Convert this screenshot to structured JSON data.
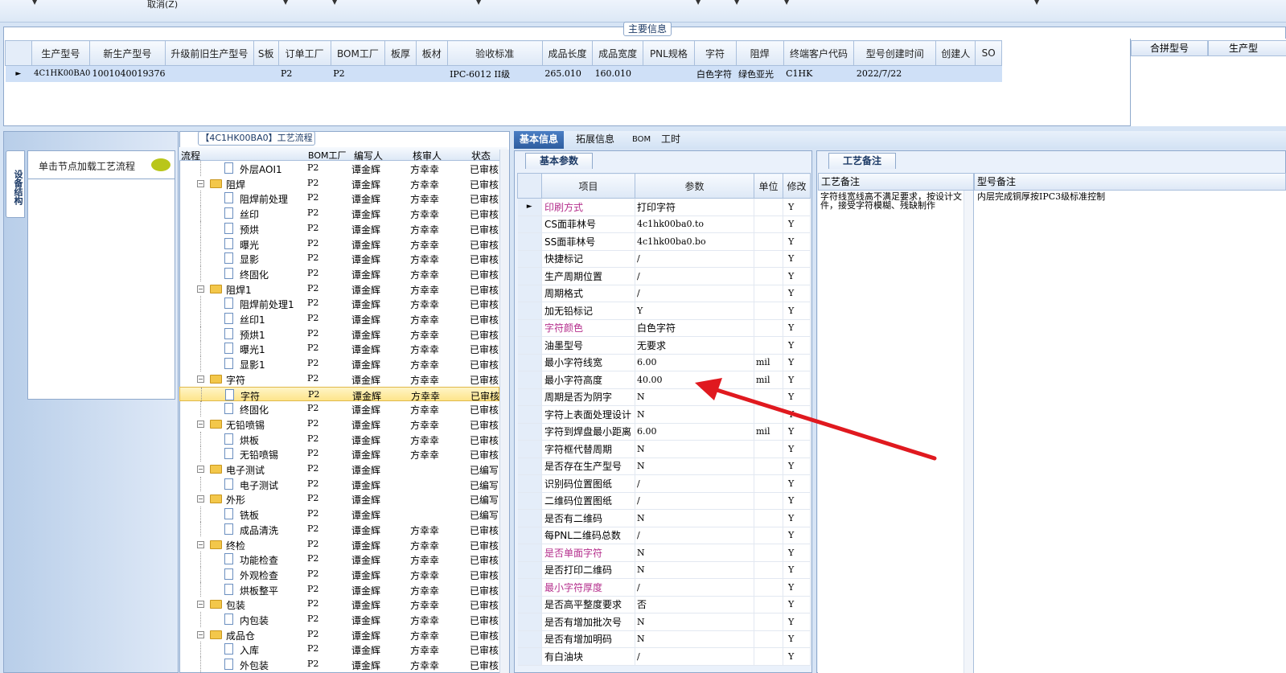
{
  "toolbar": {
    "cancel_label": "取消(Z)"
  },
  "main": {
    "title": "主要信息",
    "columns": [
      "生产型号",
      "新生产型号",
      "升级前旧生产型号",
      "S板",
      "订单工厂",
      "BOM工厂",
      "板厚",
      "板材",
      "验收标准",
      "成品长度",
      "成品宽度",
      "PNL规格",
      "字符",
      "阻焊",
      "终端客户代码",
      "型号创建时间",
      "创建人",
      "SO"
    ],
    "row": [
      "4C1HK00BA0",
      "10010400193760",
      "",
      "",
      "P2",
      "P2",
      "",
      "",
      "IPC-6012 II级",
      "265.010",
      "160.010",
      "",
      "白色字符",
      "绿色亚光",
      "C1HK",
      "2022/7/22",
      "",
      ""
    ]
  },
  "merge": {
    "columns": [
      "合拼型号",
      "生产型"
    ]
  },
  "side": {
    "tab_label": "设备结构",
    "node_hint": "单击节点加载工艺流程"
  },
  "tree": {
    "title": "【4C1HK00BA0】工艺流程",
    "headers": {
      "flow": "流程",
      "bom": "BOM工厂",
      "writer": "编写人",
      "reviewer": "核审人",
      "status": "状态"
    },
    "rows": [
      {
        "name": "外层AOI1",
        "level": 2,
        "bom": "P2",
        "writer": "谭金辉",
        "reviewer": "方幸幸",
        "status": "已审核"
      },
      {
        "name": "阻焊",
        "level": 1,
        "bom": "P2",
        "writer": "谭金辉",
        "reviewer": "方幸幸",
        "status": "已审核"
      },
      {
        "name": "阻焊前处理",
        "level": 2,
        "bom": "P2",
        "writer": "谭金辉",
        "reviewer": "方幸幸",
        "status": "已审核"
      },
      {
        "name": "丝印",
        "level": 2,
        "bom": "P2",
        "writer": "谭金辉",
        "reviewer": "方幸幸",
        "status": "已审核"
      },
      {
        "name": "预烘",
        "level": 2,
        "bom": "P2",
        "writer": "谭金辉",
        "reviewer": "方幸幸",
        "status": "已审核"
      },
      {
        "name": "曝光",
        "level": 2,
        "bom": "P2",
        "writer": "谭金辉",
        "reviewer": "方幸幸",
        "status": "已审核"
      },
      {
        "name": "显影",
        "level": 2,
        "bom": "P2",
        "writer": "谭金辉",
        "reviewer": "方幸幸",
        "status": "已审核"
      },
      {
        "name": "终固化",
        "level": 2,
        "bom": "P2",
        "writer": "谭金辉",
        "reviewer": "方幸幸",
        "status": "已审核"
      },
      {
        "name": "阻焊1",
        "level": 1,
        "bom": "P2",
        "writer": "谭金辉",
        "reviewer": "方幸幸",
        "status": "已审核"
      },
      {
        "name": "阻焊前处理1",
        "level": 2,
        "bom": "P2",
        "writer": "谭金辉",
        "reviewer": "方幸幸",
        "status": "已审核"
      },
      {
        "name": "丝印1",
        "level": 2,
        "bom": "P2",
        "writer": "谭金辉",
        "reviewer": "方幸幸",
        "status": "已审核"
      },
      {
        "name": "预烘1",
        "level": 2,
        "bom": "P2",
        "writer": "谭金辉",
        "reviewer": "方幸幸",
        "status": "已审核"
      },
      {
        "name": "曝光1",
        "level": 2,
        "bom": "P2",
        "writer": "谭金辉",
        "reviewer": "方幸幸",
        "status": "已审核"
      },
      {
        "name": "显影1",
        "level": 2,
        "bom": "P2",
        "writer": "谭金辉",
        "reviewer": "方幸幸",
        "status": "已审核"
      },
      {
        "name": "字符",
        "level": 1,
        "bom": "P2",
        "writer": "谭金辉",
        "reviewer": "方幸幸",
        "status": "已审核"
      },
      {
        "name": "字符",
        "level": 2,
        "bom": "P2",
        "writer": "谭金辉",
        "reviewer": "方幸幸",
        "status": "已审核",
        "selected": true
      },
      {
        "name": "终固化",
        "level": 2,
        "bom": "P2",
        "writer": "谭金辉",
        "reviewer": "方幸幸",
        "status": "已审核"
      },
      {
        "name": "无铅喷锡",
        "level": 1,
        "bom": "P2",
        "writer": "谭金辉",
        "reviewer": "方幸幸",
        "status": "已审核"
      },
      {
        "name": "烘板",
        "level": 2,
        "bom": "P2",
        "writer": "谭金辉",
        "reviewer": "方幸幸",
        "status": "已审核"
      },
      {
        "name": "无铅喷锡",
        "level": 2,
        "bom": "P2",
        "writer": "谭金辉",
        "reviewer": "方幸幸",
        "status": "已审核"
      },
      {
        "name": "电子测试",
        "level": 1,
        "bom": "P2",
        "writer": "谭金辉",
        "reviewer": "",
        "status": "已编写"
      },
      {
        "name": "电子测试",
        "level": 2,
        "bom": "P2",
        "writer": "谭金辉",
        "reviewer": "",
        "status": "已编写"
      },
      {
        "name": "外形",
        "level": 1,
        "bom": "P2",
        "writer": "谭金辉",
        "reviewer": "",
        "status": "已编写"
      },
      {
        "name": "铣板",
        "level": 2,
        "bom": "P2",
        "writer": "谭金辉",
        "reviewer": "",
        "status": "已编写"
      },
      {
        "name": "成品清洗",
        "level": 2,
        "bom": "P2",
        "writer": "谭金辉",
        "reviewer": "方幸幸",
        "status": "已审核"
      },
      {
        "name": "终检",
        "level": 1,
        "bom": "P2",
        "writer": "谭金辉",
        "reviewer": "方幸幸",
        "status": "已审核"
      },
      {
        "name": "功能检查",
        "level": 2,
        "bom": "P2",
        "writer": "谭金辉",
        "reviewer": "方幸幸",
        "status": "已审核"
      },
      {
        "name": "外观检查",
        "level": 2,
        "bom": "P2",
        "writer": "谭金辉",
        "reviewer": "方幸幸",
        "status": "已审核"
      },
      {
        "name": "烘板整平",
        "level": 2,
        "bom": "P2",
        "writer": "谭金辉",
        "reviewer": "方幸幸",
        "status": "已审核"
      },
      {
        "name": "包装",
        "level": 1,
        "bom": "P2",
        "writer": "谭金辉",
        "reviewer": "方幸幸",
        "status": "已审核"
      },
      {
        "name": "内包装",
        "level": 2,
        "bom": "P2",
        "writer": "谭金辉",
        "reviewer": "方幸幸",
        "status": "已审核"
      },
      {
        "name": "成品仓",
        "level": 1,
        "bom": "P2",
        "writer": "谭金辉",
        "reviewer": "方幸幸",
        "status": "已审核"
      },
      {
        "name": "入库",
        "level": 2,
        "bom": "P2",
        "writer": "谭金辉",
        "reviewer": "方幸幸",
        "status": "已审核"
      },
      {
        "name": "外包装",
        "level": 2,
        "bom": "P2",
        "writer": "谭金辉",
        "reviewer": "方幸幸",
        "status": "已审核"
      }
    ]
  },
  "tabs": [
    "基本信息",
    "拓展信息",
    "BOM",
    "工时"
  ],
  "basic": {
    "title": "基本参数",
    "headers": {
      "item": "项目",
      "param": "参数",
      "unit": "单位",
      "edit": "修改"
    },
    "rows": [
      {
        "item": "印刷方式",
        "value": "打印字符",
        "unit": "",
        "edit": "Y",
        "pink": true,
        "current": true
      },
      {
        "item": "CS面菲林号",
        "value": "4c1hk00ba0.to",
        "unit": "",
        "edit": "Y"
      },
      {
        "item": "SS面菲林号",
        "value": "4c1hk00ba0.bo",
        "unit": "",
        "edit": "Y"
      },
      {
        "item": "快捷标记",
        "value": "/",
        "unit": "",
        "edit": "Y"
      },
      {
        "item": "生产周期位置",
        "value": "/",
        "unit": "",
        "edit": "Y"
      },
      {
        "item": "周期格式",
        "value": "/",
        "unit": "",
        "edit": "Y"
      },
      {
        "item": "加无铅标记",
        "value": "Y",
        "unit": "",
        "edit": "Y"
      },
      {
        "item": "字符颜色",
        "value": "白色字符",
        "unit": "",
        "edit": "Y",
        "pink": true
      },
      {
        "item": "油墨型号",
        "value": "无要求",
        "unit": "",
        "edit": "Y"
      },
      {
        "item": "最小字符线宽",
        "value": "6.00",
        "unit": "mil",
        "edit": "Y"
      },
      {
        "item": "最小字符高度",
        "value": "40.00",
        "unit": "mil",
        "edit": "Y"
      },
      {
        "item": "周期是否为阴字",
        "value": "N",
        "unit": "",
        "edit": "Y"
      },
      {
        "item": "字符上表面处理设计",
        "value": "N",
        "unit": "",
        "edit": "Y"
      },
      {
        "item": "字符到焊盘最小距离",
        "value": "6.00",
        "unit": "mil",
        "edit": "Y"
      },
      {
        "item": "字符框代替周期",
        "value": "N",
        "unit": "",
        "edit": "Y"
      },
      {
        "item": "是否存在生产型号",
        "value": "N",
        "unit": "",
        "edit": "Y"
      },
      {
        "item": "识别码位置图纸",
        "value": "/",
        "unit": "",
        "edit": "Y"
      },
      {
        "item": "二维码位置图纸",
        "value": "/",
        "unit": "",
        "edit": "Y"
      },
      {
        "item": "是否有二维码",
        "value": "N",
        "unit": "",
        "edit": "Y"
      },
      {
        "item": "每PNL二维码总数",
        "value": "/",
        "unit": "",
        "edit": "Y"
      },
      {
        "item": "是否单面字符",
        "value": "N",
        "unit": "",
        "edit": "Y",
        "pink": true
      },
      {
        "item": "是否打印二维码",
        "value": "N",
        "unit": "",
        "edit": "Y"
      },
      {
        "item": "最小字符厚度",
        "value": "/",
        "unit": "",
        "edit": "Y",
        "pink": true
      },
      {
        "item": "是否高平整度要求",
        "value": "否",
        "unit": "",
        "edit": "Y"
      },
      {
        "item": "是否有增加批次号",
        "value": "N",
        "unit": "",
        "edit": "Y"
      },
      {
        "item": "是否有增加明码",
        "value": "N",
        "unit": "",
        "edit": "Y"
      },
      {
        "item": "有白油块",
        "value": "/",
        "unit": "",
        "edit": "Y"
      }
    ]
  },
  "craft": {
    "title": "工艺备注",
    "col1": "工艺备注",
    "col2": "型号备注",
    "note1": "字符线宽线高不满足要求，按设计文件，接受字符模糊、残缺制作",
    "note2": "内层完成铜厚按IPC3级标准控制"
  },
  "colors": {
    "accent": "#2e5d9f",
    "pink": "#b42e8c",
    "arrow": "#e0191f",
    "selected_row": "#cfe0f7"
  }
}
